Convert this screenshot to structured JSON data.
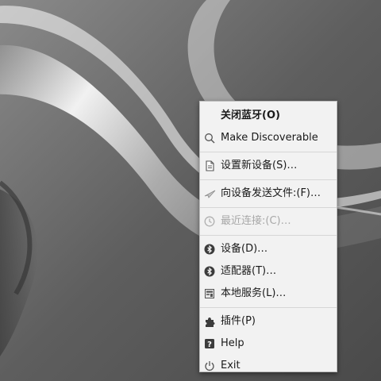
{
  "menu": {
    "items": [
      {
        "id": "toggle",
        "label": "关闭蓝牙(O)",
        "icon": "none",
        "bold": true,
        "enabled": true
      },
      {
        "id": "discoverable",
        "label": "Make Discoverable",
        "icon": "search-icon",
        "enabled": true
      },
      {
        "id": "setup",
        "label": "设置新设备(S)…",
        "icon": "new-document-icon",
        "enabled": true
      },
      {
        "id": "send",
        "label": "向设备发送文件:(F)…",
        "icon": "send-plane-icon",
        "enabled": true
      },
      {
        "id": "recent",
        "label": "最近连接:(C)…",
        "icon": "clock-icon",
        "enabled": false
      },
      {
        "id": "devices",
        "label": "设备(D)…",
        "icon": "bluetooth-icon",
        "enabled": true
      },
      {
        "id": "adapters",
        "label": "适配器(T)…",
        "icon": "bluetooth-icon",
        "enabled": true
      },
      {
        "id": "services",
        "label": "本地服务(L)…",
        "icon": "services-icon",
        "enabled": true
      },
      {
        "id": "plugins",
        "label": "插件(P)",
        "icon": "puzzle-icon",
        "enabled": true
      },
      {
        "id": "help",
        "label": "Help",
        "icon": "help-icon",
        "enabled": true
      },
      {
        "id": "exit",
        "label": "Exit",
        "icon": "power-icon",
        "enabled": true
      }
    ]
  },
  "colors": {
    "menu_bg": "#f2f2f2",
    "text": "#1a1a1a",
    "disabled_text": "#a8a8a8",
    "icon_dark": "#3c3c3c"
  }
}
